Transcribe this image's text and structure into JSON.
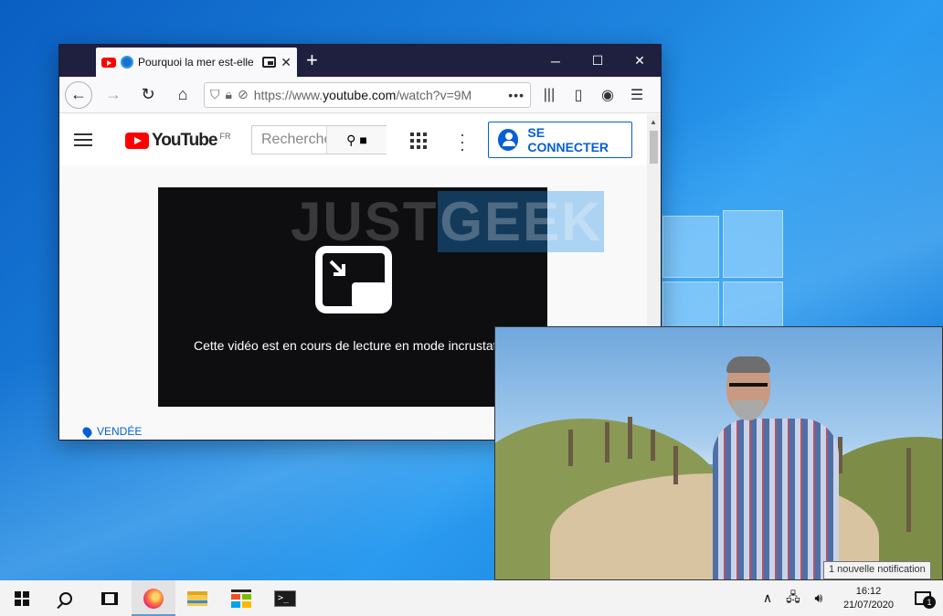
{
  "browser": {
    "tab_title": "Pourquoi la mer est-elle",
    "tab_close": "✕",
    "new_tab": "+",
    "url_prefix": "https://www.",
    "url_domain": "youtube.com",
    "url_path": "/watch?v=9M",
    "url_more": "•••",
    "window_controls": {
      "minimize": "─",
      "maximize": "☐",
      "close": "✕"
    }
  },
  "youtube": {
    "logo_text": "YouTube",
    "logo_region": "FR",
    "search_placeholder": "Recherche",
    "signin_label": "SE CONNECTER",
    "player_message": "Cette vidéo est en cours de lecture en mode incrustation.",
    "location_label": "VENDÉE"
  },
  "watermark": {
    "part1": "JUST",
    "part2": "GEEK"
  },
  "tooltip": {
    "text": "1 nouvelle notification"
  },
  "taskbar": {
    "clock_time": "16:12",
    "clock_date": "21/07/2020",
    "notification_count": "1",
    "tray_chevron": "∧"
  }
}
